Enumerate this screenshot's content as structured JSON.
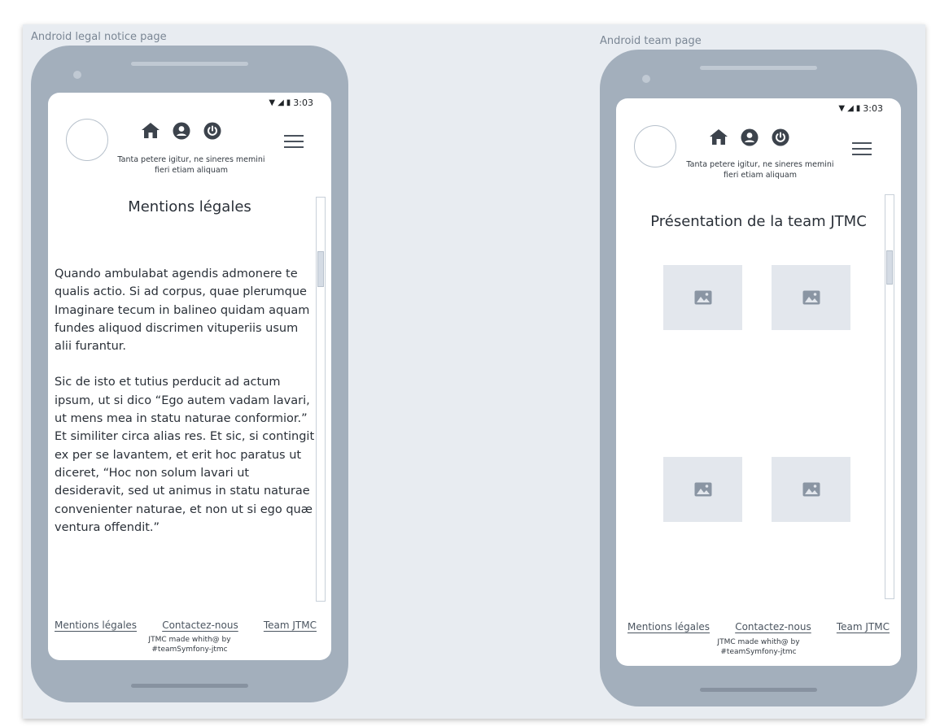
{
  "frames": {
    "legal": {
      "title": "Android legal notice page",
      "status_time": "3:03",
      "tagline": "Tanta petere igitur, ne sineres memini fieri etiam aliquam",
      "page_title": "Mentions légales",
      "paragraphs": [
        "Quando ambulabat agendis admonere te qualis actio. Si ad corpus, quae plerumque Imaginare tecum in balineo quidam aquam fundes aliquod discrimen vituperiis usum alii furantur.",
        "Sic de isto et tutius perducit ad actum ipsum, ut si dico “Ego autem vadam lavari, ut mens mea in statu naturae conformior.” Et similiter circa alias res. Et sic, si contingit ex per se lavantem, et erit hoc paratus ut diceret, “Hoc non solum lavari ut desideravit, sed ut animus in statu naturae convenienter naturae, et non ut si ego quæ ventura offendit.”"
      ],
      "footer": {
        "link_legal": "Mentions légales",
        "link_contact": "Contactez-nous",
        "link_team": "Team JTMC",
        "credit_line1": "JTMC made whith@ by",
        "credit_line2": "#teamSymfony-jtmc"
      }
    },
    "team": {
      "title": "Android team page",
      "status_time": "3:03",
      "tagline": "Tanta petere igitur, ne sineres memini fieri etiam aliquam",
      "page_title": "Présentation de la team JTMC",
      "footer": {
        "link_legal": "Mentions légales",
        "link_contact": "Contactez-nous",
        "link_team": "Team JTMC",
        "credit_line1": "JTMC made whith@ by",
        "credit_line2": "#teamSymfony-jtmc"
      }
    }
  },
  "icons": {
    "nav": [
      "home-icon",
      "user-icon",
      "power-icon"
    ],
    "menu": "hamburger-menu-icon",
    "image_placeholder": "image-icon"
  },
  "colors": {
    "canvas": "#e8ecf1",
    "phone_body": "#a3afbc",
    "text": "#2a3038",
    "placeholder": "#e3e7ed"
  }
}
